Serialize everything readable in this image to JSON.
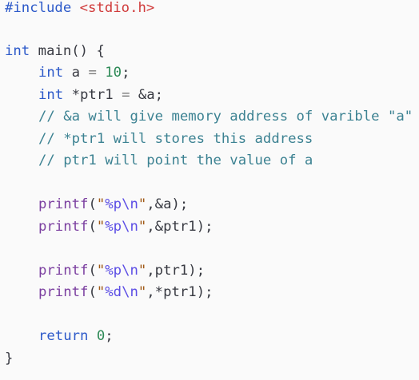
{
  "code": {
    "include_directive": "#include",
    "include_header": "<stdio.h>",
    "main_type": "int",
    "main_sig": " main() {",
    "line_a": {
      "type": "int",
      "name": " a ",
      "op": "=",
      "value": "10",
      "end": ";"
    },
    "line_ptr": {
      "type": "int",
      "name": " *ptr1 ",
      "op": "=",
      "rest": " &a;"
    },
    "comment1": "// &a will give memory address of varible \"a\"",
    "comment2": "// *ptr1 will stores this address",
    "comment3": "// ptr1 will point the value of a",
    "printf1": {
      "fn": "printf",
      "open": "(",
      "q1": "\"",
      "fmt": "%p",
      "esc": "\\n",
      "q2": "\"",
      "args": ",&a);"
    },
    "printf2": {
      "fn": "printf",
      "open": "(",
      "q1": "\"",
      "fmt": "%p",
      "esc": "\\n",
      "q2": "\"",
      "args": ",&ptr1);"
    },
    "printf3": {
      "fn": "printf",
      "open": "(",
      "q1": "\"",
      "fmt": "%p",
      "esc": "\\n",
      "q2": "\"",
      "args": ",ptr1);"
    },
    "printf4": {
      "fn": "printf",
      "open": "(",
      "q1": "\"",
      "fmt": "%d",
      "esc": "\\n",
      "q2": "\"",
      "args": ",*ptr1);"
    },
    "return_kw": "return",
    "return_val": "0",
    "return_end": ";",
    "close_brace": "}"
  },
  "colors": {
    "keyword": "#2c59c9",
    "include_header": "#d03a3a",
    "number": "#2e8a57",
    "comment": "#3c8292",
    "format_spec": "#5c4ee5",
    "background": "#fafafa"
  }
}
